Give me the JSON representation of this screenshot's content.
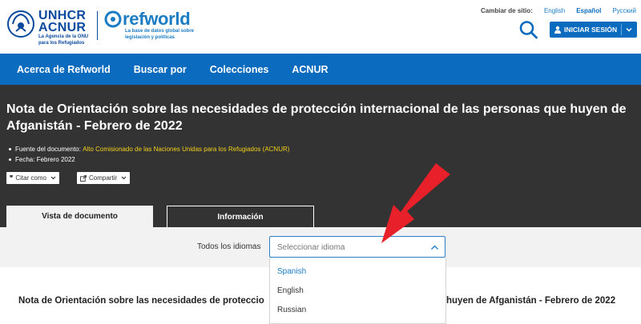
{
  "header": {
    "unhcr_title_1": "UNHCR",
    "unhcr_title_2": "ACNUR",
    "unhcr_tagline_1": "La Agencia de la ONU",
    "unhcr_tagline_2": "para los Refugiados",
    "refworld_name": "refworld",
    "refworld_tagline_1": "La base de datos global sobre",
    "refworld_tagline_2": "legislación y políticas",
    "site_switch_label": "Cambiar de sitio:",
    "languages": [
      "English",
      "Español",
      "Русский"
    ],
    "active_language": "Español",
    "login_label": "INICIAR SESIÓN",
    "accent_color": "#0a6bbf"
  },
  "nav": {
    "items": [
      "Acerca de Refworld",
      "Buscar por",
      "Colecciones",
      "ACNUR"
    ]
  },
  "document": {
    "title": "Nota de Orientación sobre las necesidades de protección internacional de las personas que huyen de Afganistán - Febrero de 2022",
    "source_label": "Fuente del documento:",
    "source_value": "Alto Comisionado de las Naciones Unidas para los Refugiados (ACNUR)",
    "date_label": "Fecha:",
    "date_value": "Febrero 2022",
    "cite_button": "Citar como",
    "share_button": "Compartir"
  },
  "tabs": {
    "document_view": "Vista de documento",
    "information": "Información"
  },
  "language_filter": {
    "label": "Todos los idiomas",
    "placeholder": "Seleccionar idioma",
    "options": [
      "Spanish",
      "English",
      "Russian"
    ]
  },
  "body": {
    "title_left": "Nota de Orientación sobre las necesidades de proteccio",
    "title_right": "huyen de Afganistán - Febrero de 2022"
  }
}
